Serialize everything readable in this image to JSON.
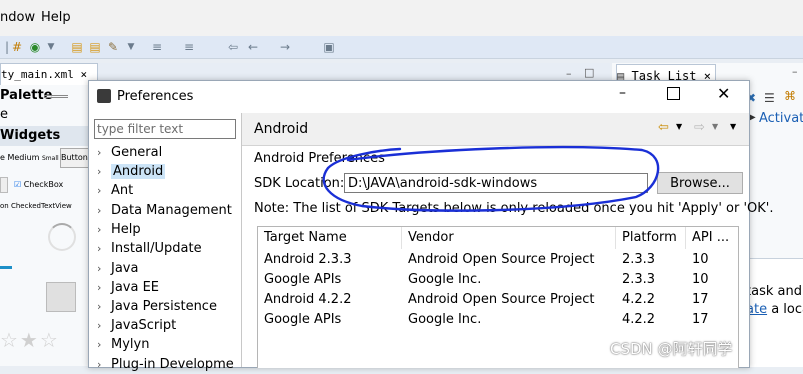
{
  "menubar": {
    "items": [
      "ndow",
      "Help"
    ]
  },
  "editor": {
    "tab_label": "ty_main.xml ⨯"
  },
  "palette": {
    "title": "Palette",
    "search": "e",
    "group": "Widgets",
    "sizes": [
      "e Medium",
      "Small",
      "Button"
    ],
    "checkbox_label": "CheckBox",
    "checkedtext_label": "on CheckedTextView"
  },
  "tasklist": {
    "tab_label": "Task List ⨯",
    "activate_label": "Activat",
    "task_text": "task and",
    "task_link": "ate",
    "task_rest": " a loca"
  },
  "dialog": {
    "title": "Preferences",
    "filter_placeholder": "type filter text",
    "tree": [
      {
        "label": "General"
      },
      {
        "label": "Android",
        "selected": true
      },
      {
        "label": "Ant"
      },
      {
        "label": "Data Management"
      },
      {
        "label": "Help"
      },
      {
        "label": "Install/Update"
      },
      {
        "label": "Java"
      },
      {
        "label": "Java EE"
      },
      {
        "label": "Java Persistence"
      },
      {
        "label": "JavaScript"
      },
      {
        "label": "Mylyn"
      },
      {
        "label": "Plug-in Developme"
      }
    ],
    "page_title": "Android",
    "section_title": "Android Preferences",
    "sdk_label": "SDK Location:",
    "sdk_value": "D:\\JAVA\\android-sdk-windows",
    "browse_label": "Browse...",
    "note": "Note: The list of SDK Targets below is only reloaded once you hit 'Apply' or 'OK'.",
    "columns": [
      "Target Name",
      "Vendor",
      "Platform",
      "API ..."
    ],
    "rows": [
      [
        "Android 2.3.3",
        "Android Open Source Project",
        "2.3.3",
        "10"
      ],
      [
        "Google APIs",
        "Google Inc.",
        "2.3.3",
        "10"
      ],
      [
        "Android 4.2.2",
        "Android Open Source Project",
        "4.2.2",
        "17"
      ],
      [
        "Google APIs",
        "Google Inc.",
        "4.2.2",
        "17"
      ]
    ]
  },
  "watermark": "CSDN @阿轩同学",
  "colors": {
    "selection": "#cce4f7",
    "annotation_ink": "#1a2fd6",
    "link": "#1a5fb4"
  }
}
